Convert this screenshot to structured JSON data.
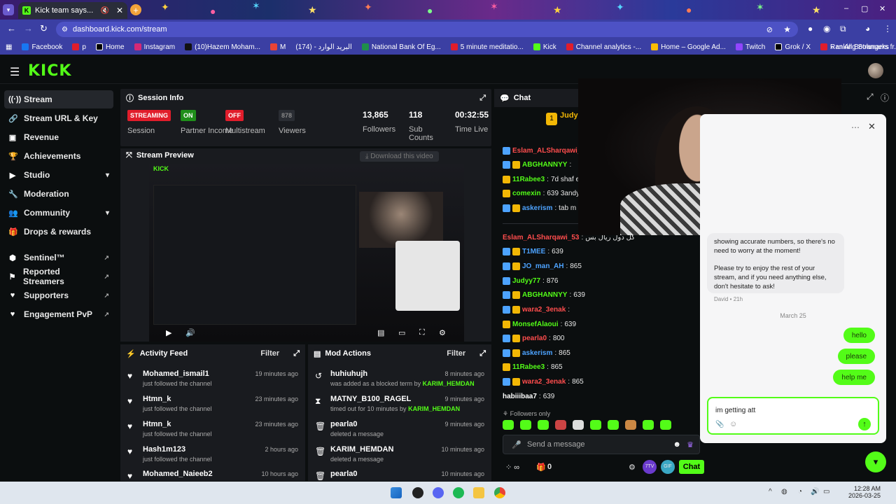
{
  "browser": {
    "tab_title": "Kick team says...",
    "url": "dashboard.kick.com/stream",
    "bookmarks": [
      "Facebook",
      "p",
      "Home",
      "Instagram",
      "(10)Hazem Moham...",
      "M",
      "(174) - البريد الوارد",
      "National Bank Of Eg...",
      "5 minute meditatio...",
      "Kick",
      "Channel analytics -...",
      "Home – Google Ad...",
      "Twitch",
      "Grok / X",
      "Ranking Strangers fr..."
    ],
    "all_bookmarks": "All Bookmarks"
  },
  "sidebar": {
    "items": [
      {
        "label": "Stream",
        "icon": "broadcast-icon"
      },
      {
        "label": "Stream URL & Key",
        "icon": "link-icon"
      },
      {
        "label": "Revenue",
        "icon": "cash-icon"
      },
      {
        "label": "Achievements",
        "icon": "trophy-icon"
      },
      {
        "label": "Studio",
        "icon": "video-icon"
      },
      {
        "label": "Moderation",
        "icon": "wrench-icon"
      },
      {
        "label": "Community",
        "icon": "people-icon"
      },
      {
        "label": "Drops & rewards",
        "icon": "gift-icon"
      },
      {
        "label": "Sentinel™",
        "icon": "shield-icon"
      },
      {
        "label": "Reported Streamers",
        "icon": "flag-icon"
      },
      {
        "label": "Supporters",
        "icon": "heart-icon"
      },
      {
        "label": "Engagement PvP",
        "icon": "heart-icon"
      }
    ]
  },
  "session": {
    "title": "Session Info",
    "streaming_badge": "STREAMING",
    "session_label": "Session",
    "partner_badge": "ON",
    "partner_label": "Partner Income",
    "multistream_badge": "OFF",
    "multistream_label": "Multistream",
    "viewers_value": "878",
    "viewers_label": "Viewers",
    "followers_value": "13,865",
    "followers_label": "Followers",
    "subs_value": "118",
    "subs_label": "Sub Counts",
    "time_value": "00:32:55",
    "time_label": "Time Live"
  },
  "preview": {
    "title": "Stream Preview",
    "download": "Download this video"
  },
  "activity": {
    "title": "Activity Feed",
    "filter": "Filter",
    "rows": [
      {
        "name": "Mohamed_ismail1",
        "sub": "just followed the channel",
        "time": "19 minutes ago"
      },
      {
        "name": "Htmn_k",
        "sub": "just followed the channel",
        "time": "23 minutes ago"
      },
      {
        "name": "Htmn_k",
        "sub": "just followed the channel",
        "time": "23 minutes ago"
      },
      {
        "name": "Hash1m123",
        "sub": "just followed the channel",
        "time": "2 hours ago"
      },
      {
        "name": "Mohamed_Naieeb2",
        "sub": "",
        "time": "10 hours ago"
      }
    ]
  },
  "mod": {
    "title": "Mod Actions",
    "filter": "Filter",
    "rows": [
      {
        "name": "huhiuhujh",
        "sub": "was added as a blocked term by",
        "by": "KARIM_HEMDAN",
        "time": "8 minutes ago"
      },
      {
        "name": "MATNY_B100_RAGEL",
        "sub": "timed out for 10 minutes by",
        "by": "KARIM_HEMDAN",
        "time": "9 minutes ago"
      },
      {
        "name": "pearla0",
        "sub": "deleted a message",
        "by": "",
        "time": "9 minutes ago"
      },
      {
        "name": "KARIM_HEMDAN",
        "sub": "deleted a message",
        "by": "",
        "time": "10 minutes ago"
      },
      {
        "name": "pearla0",
        "sub": "",
        "by": "",
        "time": "10 minutes ago"
      }
    ]
  },
  "chat": {
    "title": "Chat",
    "pinned_user": "Judy",
    "messages": [
      {
        "user": "Eslam_ALSharqawi_53",
        "color": "#ff4d4d",
        "text": ""
      },
      {
        "user": "ABGHANNYY",
        "color": "#53fc18",
        "text": ""
      },
      {
        "user": "11Rabee3",
        "color": "#53fc18",
        "text": "7d shaf el ra"
      },
      {
        "user": "comexin",
        "color": "#53fc18",
        "text": "639 3andy"
      },
      {
        "user": "askerism",
        "color": "#4da3ff",
        "text": "tab m"
      },
      {
        "user": "Eslam_ALSharqawi_53",
        "color": "#ff4d4d",
        "text": "كل دول ريال بس"
      },
      {
        "user": "T1MEE",
        "color": "#4da3ff",
        "text": "639"
      },
      {
        "user": "JO_man_AH",
        "color": "#4da3ff",
        "text": "865"
      },
      {
        "user": "Judyy77",
        "color": "#53fc18",
        "text": "876"
      },
      {
        "user": "ABGHANNYY",
        "color": "#53fc18",
        "text": "639"
      },
      {
        "user": "wara2_3enak",
        "color": "#ff4d4d",
        "text": ""
      },
      {
        "user": "MonsefAlaoui",
        "color": "#53fc18",
        "text": "639"
      },
      {
        "user": "pearla0",
        "color": "#ff4d4d",
        "text": "800"
      },
      {
        "user": "askerism",
        "color": "#4da3ff",
        "text": "865"
      },
      {
        "user": "11Rabee3",
        "color": "#53fc18",
        "text": "865"
      },
      {
        "user": "wara2_3enak",
        "color": "#ff4d4d",
        "text": "865"
      },
      {
        "user": "habiiibaa7",
        "color": "#ffffff",
        "text": "639"
      }
    ],
    "followers_only": "Followers only",
    "send_placeholder": "Send a message",
    "points_count": "0",
    "chat_button": "Chat"
  },
  "support": {
    "msg1": "showing accurate numbers, so there's no need to worry at the moment!",
    "msg2": "Please try to enjoy the rest of your stream, and if you need anything else, don't hesitate to ask!",
    "meta": "David • 21h",
    "date": "March 25",
    "mine": [
      "hello",
      "please",
      "help me"
    ],
    "draft": "im getting att"
  },
  "taskbar": {
    "time": "12:28 AM",
    "date": "2026-03-25"
  },
  "colors": {
    "accent": "#53fc18",
    "bg": "#0b0e0f",
    "panel": "#191b1f",
    "streaming": "#e11d2b"
  }
}
